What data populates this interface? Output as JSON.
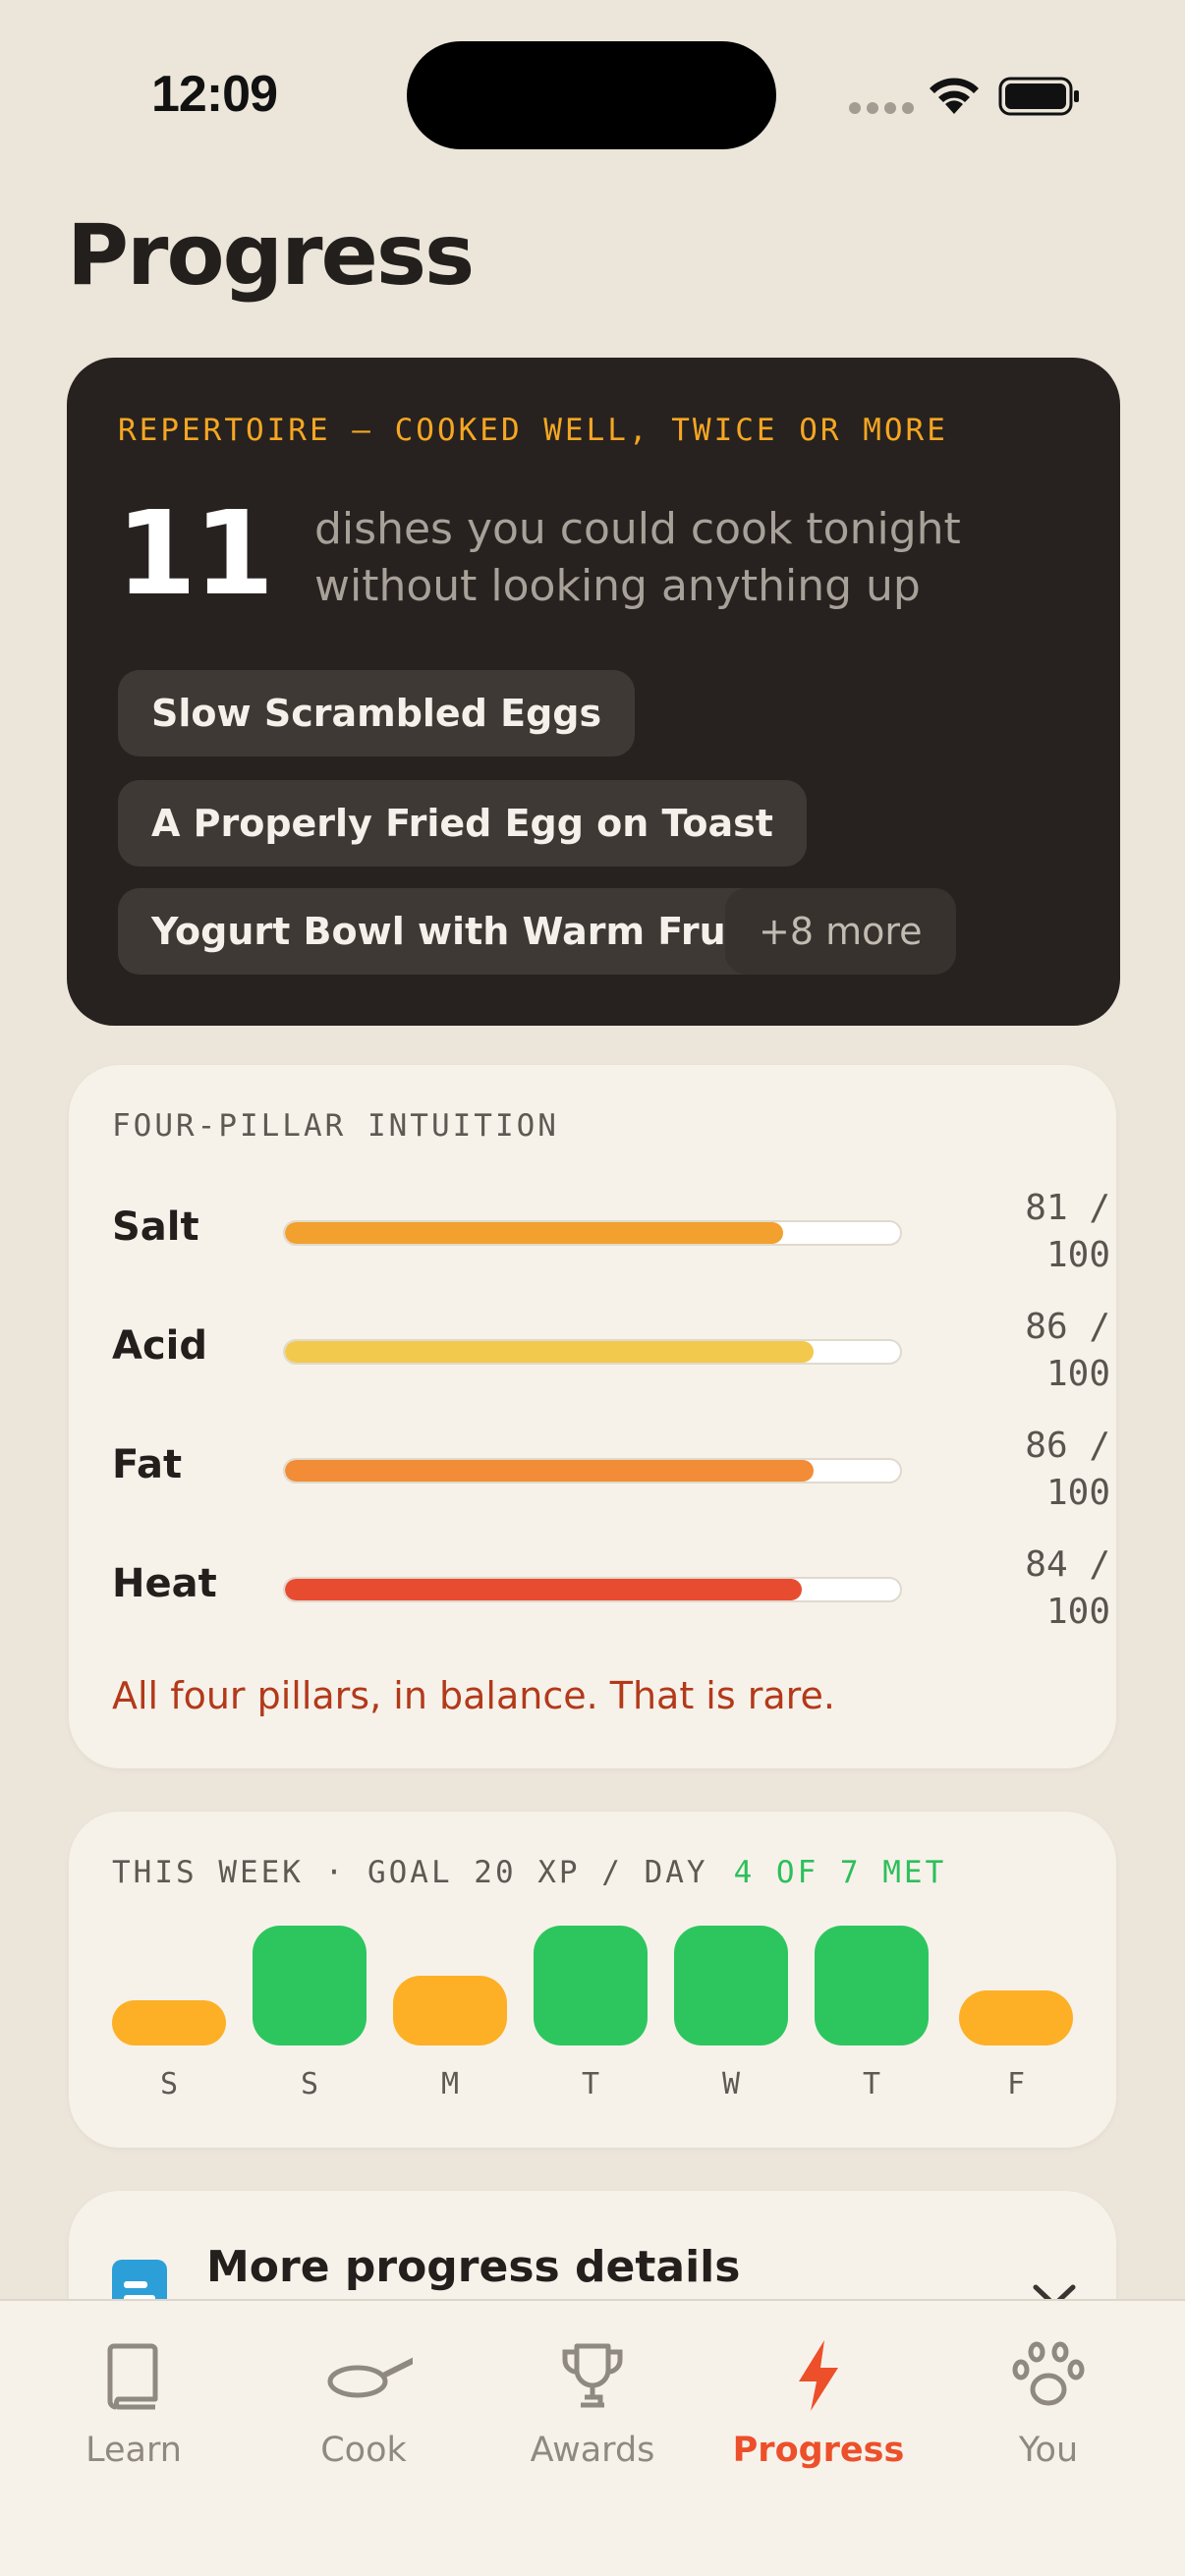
{
  "status_bar": {
    "time": "12:09"
  },
  "page": {
    "title": "Progress"
  },
  "repertoire": {
    "label": "REPERTOIRE — COOKED WELL, TWICE OR MORE",
    "count": "11",
    "description": "dishes you could cook tonight without looking anything up",
    "dishes": [
      "Slow Scrambled Eggs",
      "A Properly Fried Egg on Toast",
      "Yogurt Bowl with Warm Fruit"
    ],
    "more_label": "+8 more"
  },
  "pillars": {
    "label": "FOUR-PILLAR INTUITION",
    "items": [
      {
        "name": "Salt",
        "score": "81 /\n100",
        "value": 81,
        "color": "#f2a02e"
      },
      {
        "name": "Acid",
        "score": "86 /\n100",
        "value": 86,
        "color": "#f2c94c"
      },
      {
        "name": "Fat",
        "score": "86 /\n100",
        "value": 86,
        "color": "#f28c36"
      },
      {
        "name": "Heat",
        "score": "84 /\n100",
        "value": 84,
        "color": "#e84c30"
      }
    ],
    "note": "All four pillars, in balance. That is rare."
  },
  "week": {
    "goal_label": "THIS WEEK · GOAL 20 XP / DAY",
    "met_label": "4 OF 7 MET",
    "colors": {
      "met": "#2dc65e",
      "missed": "#fdb025"
    },
    "days": [
      {
        "letter": "S",
        "met": false,
        "xp_fraction": 0.38
      },
      {
        "letter": "S",
        "met": true,
        "xp_fraction": 1.0
      },
      {
        "letter": "M",
        "met": false,
        "xp_fraction": 0.58
      },
      {
        "letter": "T",
        "met": true,
        "xp_fraction": 1.0
      },
      {
        "letter": "W",
        "met": true,
        "xp_fraction": 1.0
      },
      {
        "letter": "T",
        "met": true,
        "xp_fraction": 1.0
      },
      {
        "letter": "F",
        "met": false,
        "xp_fraction": 0.46
      }
    ]
  },
  "details": {
    "title": "More progress details",
    "icon": "chart-document-icon"
  },
  "tabs": [
    {
      "label": "Learn",
      "icon": "book-icon",
      "active": false
    },
    {
      "label": "Cook",
      "icon": "pan-icon",
      "active": false
    },
    {
      "label": "Awards",
      "icon": "trophy-icon",
      "active": false
    },
    {
      "label": "Progress",
      "icon": "lightning-icon",
      "active": true
    },
    {
      "label": "You",
      "icon": "paw-icon",
      "active": false
    }
  ],
  "accent_color": "#ec4f2a"
}
